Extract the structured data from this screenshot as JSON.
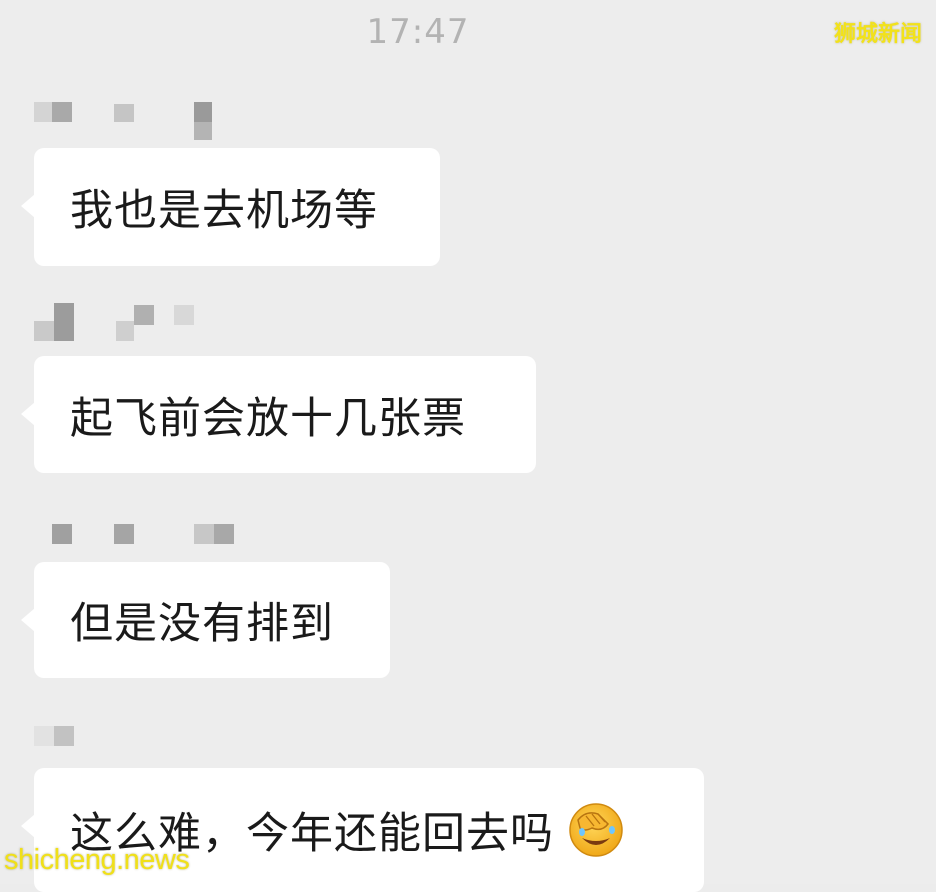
{
  "chat": {
    "timestamp": "17:47",
    "messages": [
      {
        "sender": "",
        "text": "我也是去机场等"
      },
      {
        "sender": "",
        "text": "起飞前会放十几张票"
      },
      {
        "sender": "",
        "text": "但是没有排到"
      },
      {
        "sender": "",
        "text": "这么难，今年还能回去吗",
        "emoji": "face-palm-emoji"
      }
    ]
  },
  "watermarks": {
    "top_right": "狮城新闻",
    "bottom_left": "shicheng.news"
  },
  "colors": {
    "background": "#ededed",
    "bubble": "#ffffff",
    "text": "#1a1a1a",
    "timestamp": "#b3b3b3",
    "watermark": "#f2e21a"
  }
}
